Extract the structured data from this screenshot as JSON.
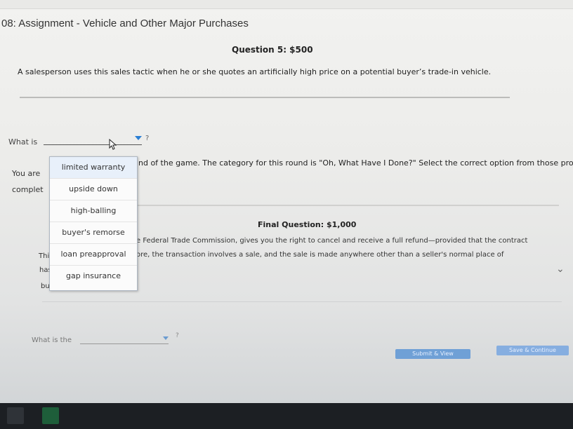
{
  "page": {
    "title": "08: Assignment - Vehicle and Other Major Purchases"
  },
  "question5": {
    "heading": "Question 5: $500",
    "text": "A salesperson uses this sales tactic when he or she quotes an artificially high price on a potential buyer’s trade-in vehicle.",
    "prompt": "What is",
    "suffix": "?"
  },
  "dropdown": {
    "options": [
      "limited warranty",
      "upside down",
      "high-balling",
      "buyer's remorse",
      "loan preapproval",
      "gap insurance"
    ]
  },
  "intro": {
    "left_word_1": "You are",
    "left_word_2": "complet",
    "line_1": "nd of the game. The category for this round is \"Oh, What Have I Done?\" Select the correct option from those provid"
  },
  "final": {
    "heading": "Final Question: $1,000",
    "left_1": "This",
    "left_2": "has",
    "left_3": "busi",
    "line_1": "e Federal Trade Commission, gives you the right to cancel and receive a full refund—provided that the contract",
    "line_2": "ore, the transaction involves a sale, and the sale is made anywhere other than a seller's normal place of",
    "prompt": "What is the",
    "suffix": "?"
  },
  "buttons": {
    "submit_label": "Submit & View",
    "save_label": "Save & Continue"
  },
  "colors": {
    "accent": "#2b7fd4",
    "button": "#6fa0d6",
    "taskbar": "#1c1f23"
  }
}
